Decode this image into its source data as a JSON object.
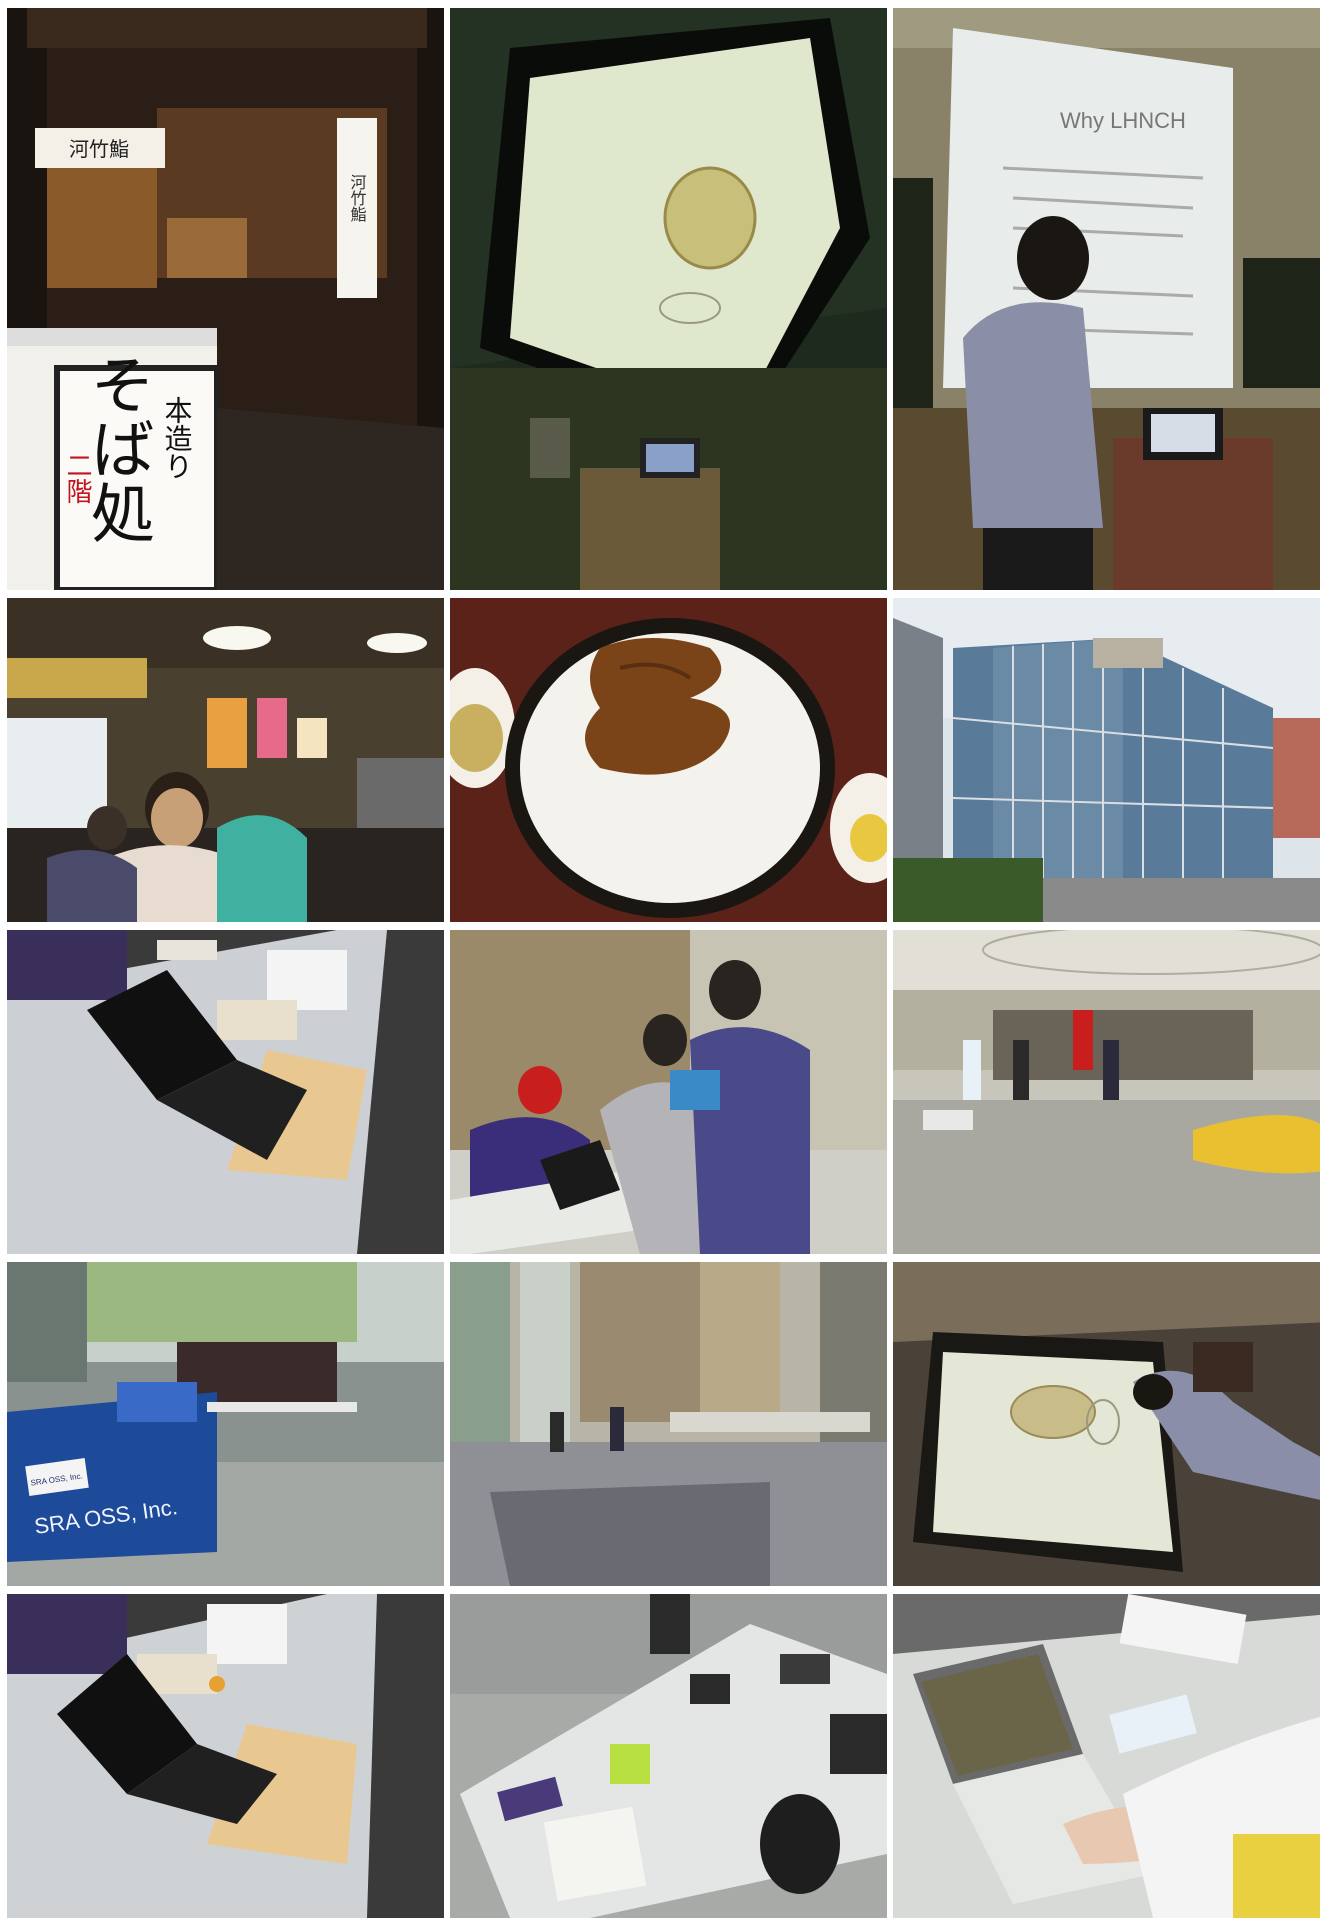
{
  "photos": [
    {
      "id": "p1",
      "scene": "soba-restaurant-entrance",
      "sign_top": "河竹鮨",
      "sign_side": "河竹鮨",
      "lantern_text": "本造り",
      "lantern_big": "そば処",
      "lantern_red": "二階"
    },
    {
      "id": "p2",
      "scene": "projector-screen-pufferfish"
    },
    {
      "id": "p3",
      "scene": "presenter-at-screen",
      "screen_title": "Why LHNCH"
    },
    {
      "id": "p4",
      "scene": "restaurant-interior-diners"
    },
    {
      "id": "p5",
      "scene": "katsu-rice-bowl"
    },
    {
      "id": "p6",
      "scene": "glass-building-exterior"
    },
    {
      "id": "p7",
      "scene": "laptop-on-booth-table"
    },
    {
      "id": "p8",
      "scene": "booth-visitors"
    },
    {
      "id": "p9",
      "scene": "exhibition-hall"
    },
    {
      "id": "p10",
      "scene": "sra-oss-booth",
      "banner_text": "SRA OSS, Inc.",
      "sign_text": "SRA OSS, Inc."
    },
    {
      "id": "p11",
      "scene": "atrium-hall"
    },
    {
      "id": "p12",
      "scene": "rotated-projector-screen"
    },
    {
      "id": "p13",
      "scene": "laptop-on-booth-table-2"
    },
    {
      "id": "p14",
      "scene": "table-with-flyers"
    },
    {
      "id": "p15",
      "scene": "hands-on-laptop"
    }
  ]
}
